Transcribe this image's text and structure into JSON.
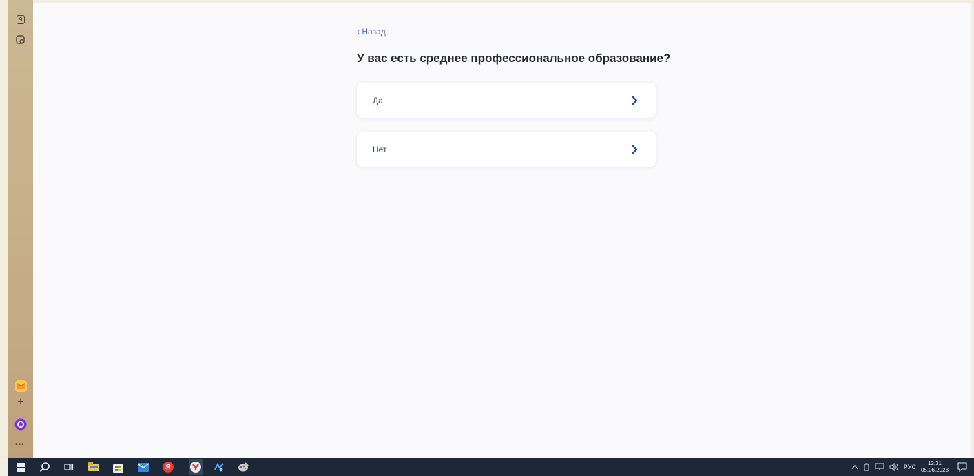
{
  "sidebar": {
    "items": [
      {
        "name": "calendar",
        "label": "9"
      },
      {
        "name": "screenshot"
      }
    ],
    "bottom": {
      "add_label": "+",
      "more_label": "•••"
    }
  },
  "page": {
    "back_label": "‹ Назад",
    "question": "У вас есть среднее профессиональное образование?",
    "options": [
      {
        "label": "Да"
      },
      {
        "label": "Нет"
      }
    ]
  },
  "taskbar": {
    "tray": {
      "language": "РУС",
      "time": "12:31",
      "date": "05.06.2023",
      "yandex_label": "Я"
    }
  },
  "colors": {
    "page_bg": "#fafafd",
    "accent": "#2d4f8f",
    "link": "#4b6bb0",
    "taskbar": "#1c2838"
  }
}
